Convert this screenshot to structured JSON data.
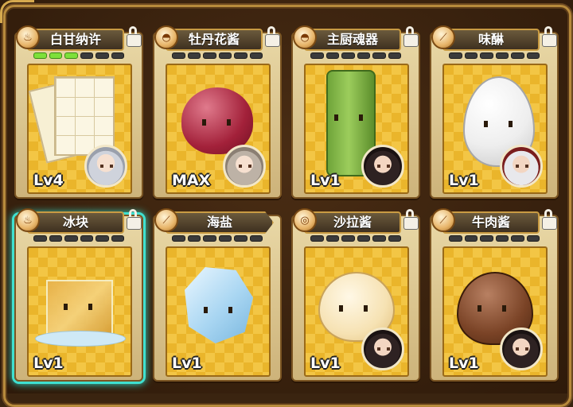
{
  "cards": [
    {
      "name": "白甘纳许",
      "level": "Lv4",
      "progress": [
        1,
        1,
        1,
        0,
        0,
        0,
        0,
        0
      ],
      "category": "dessert",
      "locked": true
    },
    {
      "name": "牡丹花酱",
      "level": "MAX",
      "progress": [
        0,
        0,
        0,
        0,
        0,
        0,
        0,
        0
      ],
      "category": "bread",
      "locked": true
    },
    {
      "name": "主厨魂器",
      "level": "Lv1",
      "progress": [
        0,
        0,
        0,
        0,
        0,
        0,
        0,
        0
      ],
      "category": "bread",
      "locked": true
    },
    {
      "name": "味醂",
      "level": "Lv1",
      "progress": [
        0,
        0,
        0,
        0,
        0,
        0,
        0,
        0
      ],
      "category": "stick",
      "locked": true
    },
    {
      "name": "冰块",
      "level": "Lv1",
      "progress": [
        0,
        0,
        0,
        0,
        0,
        0,
        0,
        0
      ],
      "category": "dessert",
      "locked": true,
      "selected": true
    },
    {
      "name": "海盐",
      "level": "Lv1",
      "progress": [
        0,
        0,
        0,
        0,
        0,
        0,
        0,
        0
      ],
      "category": "stick",
      "locked": false
    },
    {
      "name": "沙拉酱",
      "level": "Lv1",
      "progress": [
        0,
        0,
        0,
        0,
        0,
        0,
        0,
        0
      ],
      "category": "plate",
      "locked": true
    },
    {
      "name": "牛肉酱",
      "level": "Lv1",
      "progress": [
        0,
        0,
        0,
        0,
        0,
        0,
        0,
        0
      ],
      "category": "stick",
      "locked": true
    }
  ],
  "colors": {
    "background": "#3a2410",
    "card_art": "#eab52b",
    "selected_glow": "#3fe0d0",
    "progress_on": "#7ee03a",
    "progress_off": "#3b3b3b"
  },
  "icons": {
    "dessert": "teacup-icon",
    "bread": "bread-icon",
    "stick": "skewer-icon",
    "plate": "plate-icon",
    "lock": "lock-icon"
  }
}
